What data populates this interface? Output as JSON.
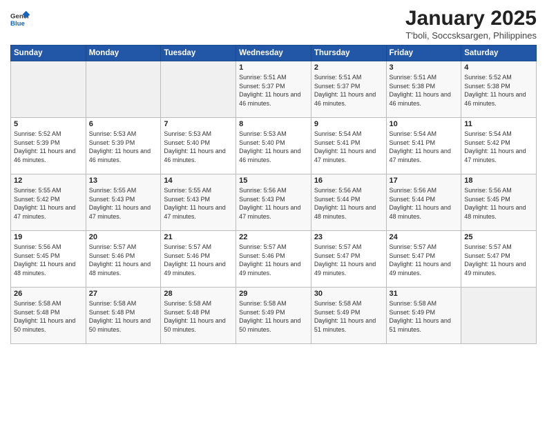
{
  "header": {
    "logo_general": "General",
    "logo_blue": "Blue",
    "title": "January 2025",
    "subtitle": "T'boli, Soccsksargen, Philippines"
  },
  "days": [
    "Sunday",
    "Monday",
    "Tuesday",
    "Wednesday",
    "Thursday",
    "Friday",
    "Saturday"
  ],
  "weeks": [
    [
      {
        "date": "",
        "sunrise": "",
        "sunset": "",
        "daylight": ""
      },
      {
        "date": "",
        "sunrise": "",
        "sunset": "",
        "daylight": ""
      },
      {
        "date": "",
        "sunrise": "",
        "sunset": "",
        "daylight": ""
      },
      {
        "date": "1",
        "sunrise": "Sunrise: 5:51 AM",
        "sunset": "Sunset: 5:37 PM",
        "daylight": "Daylight: 11 hours and 46 minutes."
      },
      {
        "date": "2",
        "sunrise": "Sunrise: 5:51 AM",
        "sunset": "Sunset: 5:37 PM",
        "daylight": "Daylight: 11 hours and 46 minutes."
      },
      {
        "date": "3",
        "sunrise": "Sunrise: 5:51 AM",
        "sunset": "Sunset: 5:38 PM",
        "daylight": "Daylight: 11 hours and 46 minutes."
      },
      {
        "date": "4",
        "sunrise": "Sunrise: 5:52 AM",
        "sunset": "Sunset: 5:38 PM",
        "daylight": "Daylight: 11 hours and 46 minutes."
      }
    ],
    [
      {
        "date": "5",
        "sunrise": "Sunrise: 5:52 AM",
        "sunset": "Sunset: 5:39 PM",
        "daylight": "Daylight: 11 hours and 46 minutes."
      },
      {
        "date": "6",
        "sunrise": "Sunrise: 5:53 AM",
        "sunset": "Sunset: 5:39 PM",
        "daylight": "Daylight: 11 hours and 46 minutes."
      },
      {
        "date": "7",
        "sunrise": "Sunrise: 5:53 AM",
        "sunset": "Sunset: 5:40 PM",
        "daylight": "Daylight: 11 hours and 46 minutes."
      },
      {
        "date": "8",
        "sunrise": "Sunrise: 5:53 AM",
        "sunset": "Sunset: 5:40 PM",
        "daylight": "Daylight: 11 hours and 46 minutes."
      },
      {
        "date": "9",
        "sunrise": "Sunrise: 5:54 AM",
        "sunset": "Sunset: 5:41 PM",
        "daylight": "Daylight: 11 hours and 47 minutes."
      },
      {
        "date": "10",
        "sunrise": "Sunrise: 5:54 AM",
        "sunset": "Sunset: 5:41 PM",
        "daylight": "Daylight: 11 hours and 47 minutes."
      },
      {
        "date": "11",
        "sunrise": "Sunrise: 5:54 AM",
        "sunset": "Sunset: 5:42 PM",
        "daylight": "Daylight: 11 hours and 47 minutes."
      }
    ],
    [
      {
        "date": "12",
        "sunrise": "Sunrise: 5:55 AM",
        "sunset": "Sunset: 5:42 PM",
        "daylight": "Daylight: 11 hours and 47 minutes."
      },
      {
        "date": "13",
        "sunrise": "Sunrise: 5:55 AM",
        "sunset": "Sunset: 5:43 PM",
        "daylight": "Daylight: 11 hours and 47 minutes."
      },
      {
        "date": "14",
        "sunrise": "Sunrise: 5:55 AM",
        "sunset": "Sunset: 5:43 PM",
        "daylight": "Daylight: 11 hours and 47 minutes."
      },
      {
        "date": "15",
        "sunrise": "Sunrise: 5:56 AM",
        "sunset": "Sunset: 5:43 PM",
        "daylight": "Daylight: 11 hours and 47 minutes."
      },
      {
        "date": "16",
        "sunrise": "Sunrise: 5:56 AM",
        "sunset": "Sunset: 5:44 PM",
        "daylight": "Daylight: 11 hours and 48 minutes."
      },
      {
        "date": "17",
        "sunrise": "Sunrise: 5:56 AM",
        "sunset": "Sunset: 5:44 PM",
        "daylight": "Daylight: 11 hours and 48 minutes."
      },
      {
        "date": "18",
        "sunrise": "Sunrise: 5:56 AM",
        "sunset": "Sunset: 5:45 PM",
        "daylight": "Daylight: 11 hours and 48 minutes."
      }
    ],
    [
      {
        "date": "19",
        "sunrise": "Sunrise: 5:56 AM",
        "sunset": "Sunset: 5:45 PM",
        "daylight": "Daylight: 11 hours and 48 minutes."
      },
      {
        "date": "20",
        "sunrise": "Sunrise: 5:57 AM",
        "sunset": "Sunset: 5:46 PM",
        "daylight": "Daylight: 11 hours and 48 minutes."
      },
      {
        "date": "21",
        "sunrise": "Sunrise: 5:57 AM",
        "sunset": "Sunset: 5:46 PM",
        "daylight": "Daylight: 11 hours and 49 minutes."
      },
      {
        "date": "22",
        "sunrise": "Sunrise: 5:57 AM",
        "sunset": "Sunset: 5:46 PM",
        "daylight": "Daylight: 11 hours and 49 minutes."
      },
      {
        "date": "23",
        "sunrise": "Sunrise: 5:57 AM",
        "sunset": "Sunset: 5:47 PM",
        "daylight": "Daylight: 11 hours and 49 minutes."
      },
      {
        "date": "24",
        "sunrise": "Sunrise: 5:57 AM",
        "sunset": "Sunset: 5:47 PM",
        "daylight": "Daylight: 11 hours and 49 minutes."
      },
      {
        "date": "25",
        "sunrise": "Sunrise: 5:57 AM",
        "sunset": "Sunset: 5:47 PM",
        "daylight": "Daylight: 11 hours and 49 minutes."
      }
    ],
    [
      {
        "date": "26",
        "sunrise": "Sunrise: 5:58 AM",
        "sunset": "Sunset: 5:48 PM",
        "daylight": "Daylight: 11 hours and 50 minutes."
      },
      {
        "date": "27",
        "sunrise": "Sunrise: 5:58 AM",
        "sunset": "Sunset: 5:48 PM",
        "daylight": "Daylight: 11 hours and 50 minutes."
      },
      {
        "date": "28",
        "sunrise": "Sunrise: 5:58 AM",
        "sunset": "Sunset: 5:48 PM",
        "daylight": "Daylight: 11 hours and 50 minutes."
      },
      {
        "date": "29",
        "sunrise": "Sunrise: 5:58 AM",
        "sunset": "Sunset: 5:49 PM",
        "daylight": "Daylight: 11 hours and 50 minutes."
      },
      {
        "date": "30",
        "sunrise": "Sunrise: 5:58 AM",
        "sunset": "Sunset: 5:49 PM",
        "daylight": "Daylight: 11 hours and 51 minutes."
      },
      {
        "date": "31",
        "sunrise": "Sunrise: 5:58 AM",
        "sunset": "Sunset: 5:49 PM",
        "daylight": "Daylight: 11 hours and 51 minutes."
      },
      {
        "date": "",
        "sunrise": "",
        "sunset": "",
        "daylight": ""
      }
    ]
  ]
}
